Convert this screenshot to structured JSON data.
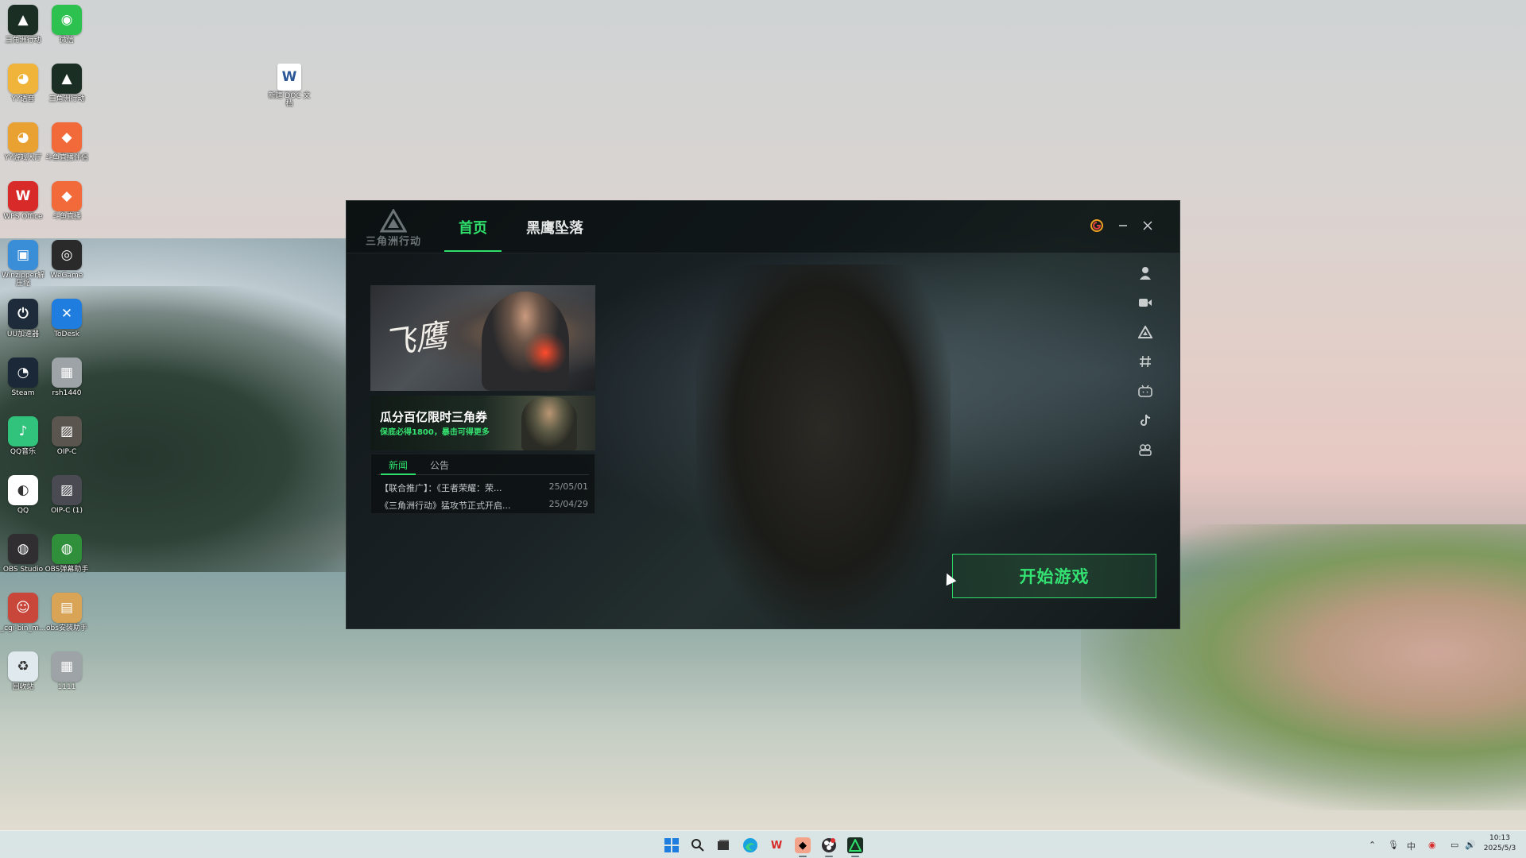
{
  "desktop": {
    "icons": [
      {
        "label": "三角洲行动",
        "color": "#1b2e23",
        "glyph": "▲"
      },
      {
        "label": "微信",
        "color": "#2dc24f",
        "glyph": "◉"
      },
      {
        "label": "YY语音",
        "color": "#f0b43a",
        "glyph": "◕"
      },
      {
        "label": "三角洲行动",
        "color": "#1b2e23",
        "glyph": "▲"
      },
      {
        "label": "YY游戏大厅",
        "color": "#e9a232",
        "glyph": "◕"
      },
      {
        "label": "斗鱼直播伴侣",
        "color": "#f36a3a",
        "glyph": "◆"
      },
      {
        "label": "WPS Office",
        "color": "#d92a2a",
        "glyph": "W"
      },
      {
        "label": "斗鱼直播",
        "color": "#f36a3a",
        "glyph": "◆"
      },
      {
        "label": "Winzipper解压缩",
        "color": "#3a8ed8",
        "glyph": "▣"
      },
      {
        "label": "WeGame",
        "color": "#2a2a2a",
        "glyph": "◎"
      },
      {
        "label": "UU加速器",
        "color": "#1d2b3a",
        "glyph": "⏻"
      },
      {
        "label": "ToDesk",
        "color": "#1f7de0",
        "glyph": "✕"
      },
      {
        "label": "Steam",
        "color": "#1b2838",
        "glyph": "◔"
      },
      {
        "label": "rsh1440",
        "color": "#9da3a6",
        "glyph": "▦"
      },
      {
        "label": "QQ音乐",
        "color": "#31c27c",
        "glyph": "♪"
      },
      {
        "label": "OIP-C",
        "color": "#5b5550",
        "glyph": "▨"
      },
      {
        "label": "QQ",
        "color": "#ffffff",
        "glyph": "◐"
      },
      {
        "label": "OIP-C (1)",
        "color": "#4a4a52",
        "glyph": "▨"
      },
      {
        "label": "OBS Studio",
        "color": "#302e31",
        "glyph": "◍"
      },
      {
        "label": "OBS弹幕助手",
        "color": "#2f8f3a",
        "glyph": "◍"
      },
      {
        "label": "_cgi-bin_m...",
        "color": "#c9463a",
        "glyph": "☺"
      },
      {
        "label": "obs安装助手",
        "color": "#d9a455",
        "glyph": "▤"
      },
      {
        "label": "回收站",
        "color": "#dfe9ee",
        "glyph": "♻"
      },
      {
        "label": "1111",
        "color": "#9da3a6",
        "glyph": "▦"
      }
    ],
    "doc_icon": {
      "label": "新建 DOC 文档",
      "glyph": "W"
    }
  },
  "launcher": {
    "logo_text": "三角洲行动",
    "tabs": {
      "home": "首页",
      "blackhawk": "黑鹰坠落"
    },
    "banner1": {
      "calligraphy": "飞鹰"
    },
    "banner2": {
      "title": "瓜分百亿限时三角券",
      "subtitle": "保底必得1800，暴击可得更多"
    },
    "news": {
      "tab_news": "新闻",
      "tab_notice": "公告",
      "items": [
        {
          "title": "【联合推广】：《王者荣耀：荣...",
          "date": "25/05/01"
        },
        {
          "title": "《三角洲行动》猛攻节正式开启...",
          "date": "25/04/29"
        }
      ]
    },
    "start_button": "开始游戏",
    "side_icons": [
      "user-icon",
      "video-icon",
      "triangle-icon",
      "hashtag-icon",
      "bilibili-icon",
      "douyin-icon",
      "community-icon"
    ]
  },
  "taskbar": {
    "time": "10:13",
    "date": "2025/5/3"
  },
  "colors": {
    "accent": "#2ee06b"
  }
}
